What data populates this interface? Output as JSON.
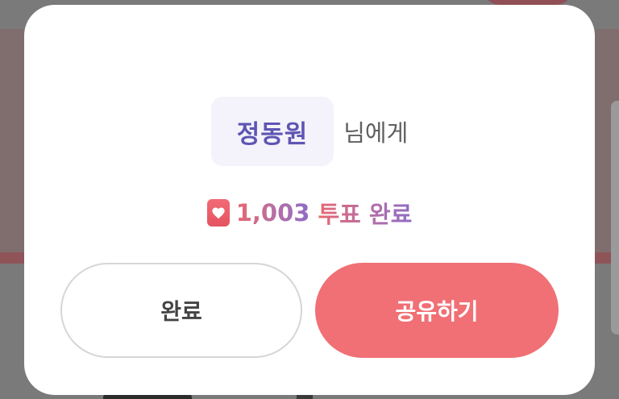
{
  "dialog": {
    "recipient_name": "정동원",
    "recipient_suffix": "님에게",
    "vote_count": "1,003",
    "vote_suffix": "투표 완료",
    "icon": "heart-icon",
    "buttons": {
      "done_label": "완료",
      "share_label": "공유하기"
    }
  },
  "colors": {
    "name": "#5e55b3",
    "accent_start": "#e86870",
    "accent_end": "#8f6cc6",
    "share_button": "#f07075",
    "chip_bg": "#f4f3fb"
  }
}
